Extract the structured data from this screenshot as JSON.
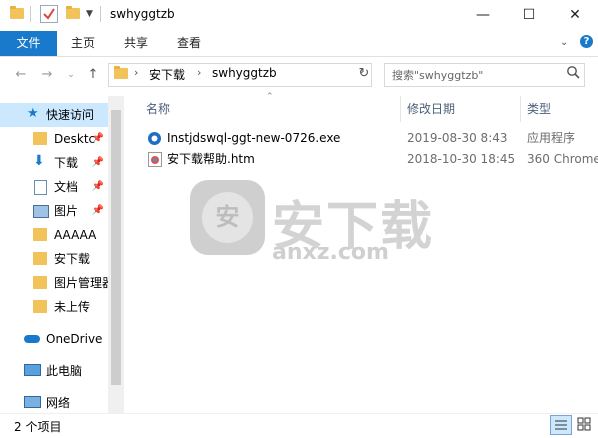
{
  "window": {
    "title": "swhyggtzb",
    "controls": [
      "—",
      "☐",
      "✕"
    ]
  },
  "ribbon": {
    "tabs": [
      "文件",
      "主页",
      "共享",
      "查看"
    ]
  },
  "address": {
    "breadcrumb": [
      "安下载",
      "swhyggtzb"
    ],
    "search_placeholder": "搜索\"swhyggtzb\""
  },
  "sidebar": {
    "items": [
      {
        "label": "快速访问",
        "icon": "star-icon",
        "selected": true
      },
      {
        "label": "Desktc",
        "icon": "folder-icon",
        "pinned": true
      },
      {
        "label": "下载",
        "icon": "download-icon",
        "pinned": true
      },
      {
        "label": "文档",
        "icon": "document-icon",
        "pinned": true
      },
      {
        "label": "图片",
        "icon": "picture-icon",
        "pinned": true
      },
      {
        "label": "AAAAA",
        "icon": "folder-icon"
      },
      {
        "label": "安下载",
        "icon": "folder-icon"
      },
      {
        "label": "图片管理器",
        "icon": "folder-icon"
      },
      {
        "label": "未上传",
        "icon": "folder-icon"
      },
      {
        "label": "OneDrive",
        "icon": "cloud-icon"
      },
      {
        "label": "此电脑",
        "icon": "computer-icon"
      },
      {
        "label": "网络",
        "icon": "network-icon"
      }
    ]
  },
  "columns": {
    "name": "名称",
    "modified": "修改日期",
    "type": "类型"
  },
  "files": [
    {
      "name": "Instjdswql-ggt-new-0726.exe",
      "modified": "2019-08-30 8:43",
      "type": "应用程序",
      "icon": "installer-icon"
    },
    {
      "name": "安下载帮助.htm",
      "modified": "2018-10-30 18:45",
      "type": "360 Chrome",
      "icon": "html-file-icon"
    }
  ],
  "status": {
    "count_text": "2 个项目"
  },
  "watermark": {
    "title": "安下载",
    "subtitle": "anxz.com",
    "logo_char": "安"
  },
  "colors": {
    "accent": "#1979ca",
    "selection": "#cce8ff"
  }
}
